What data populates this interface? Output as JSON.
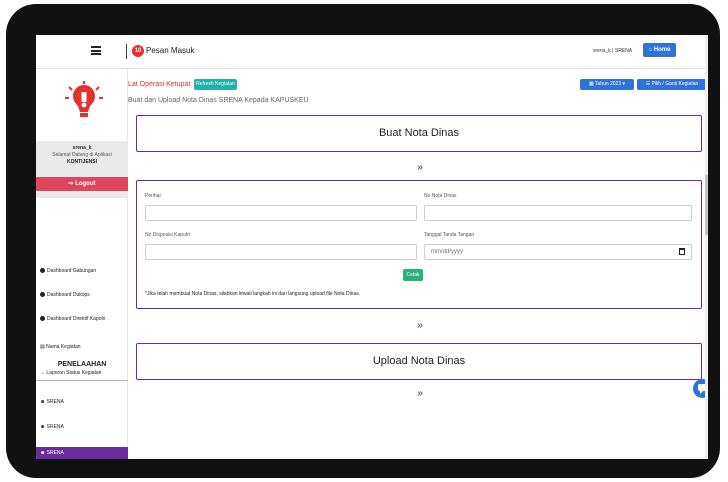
{
  "topbar": {
    "notif_count": "10",
    "pesan_label": "Pesan Masuk",
    "user_info": "srena_k | SRENA",
    "home_label": "Home"
  },
  "sidebar": {
    "username": "srena_k",
    "welcome": "Selamat Datang di Aplikasi",
    "app_name": "KONTIJENSI",
    "logout_label": "Logout",
    "menu": [
      {
        "label": "Dashboard Gabungan"
      },
      {
        "label": "Dashboard Dukops"
      },
      {
        "label": "Dashboard Direktif Kapolri"
      },
      {
        "label": "Nama Kegiatan"
      },
      {
        "label": "Laporan Status Kegiatan"
      }
    ],
    "section_title": "PENELAAHAN",
    "srena_items": [
      "SRENA",
      "SRENA",
      "SRENA"
    ]
  },
  "main": {
    "lat_op": "Lat Operasi Ketupat",
    "refresh_label": "Refresh Kegiatan",
    "tahun_label": "Tahun 2023",
    "pilih_label": "Pilih / Ganti Kegiatan",
    "page_title": "Buat dan Upload Nota Dinas SRENA Kepada KAPUSKEU",
    "card1_title": "Buat Nota Dinas",
    "form": {
      "perihal_label": "Perihal",
      "no_nota_label": "No Nota Dinas",
      "no_disposisi_label": "No Disposisi Kapolri",
      "tanggal_label": "Tanggal Tanda Tangan",
      "date_placeholder": "mm/dd/yyyy",
      "cetak_label": "Cetak",
      "note": "*Jika telah membuat Nota Dinas, silahkan lewati langkah ini dan langsung upload file Nota Dinas."
    },
    "card3_title": "Upload Nota Dinas"
  },
  "colors": {
    "accent_purple": "#6a2b9e",
    "primary_blue": "#2f73d9",
    "teal": "#20b2aa",
    "green": "#2ab07a",
    "logout_red": "#e0465b"
  }
}
